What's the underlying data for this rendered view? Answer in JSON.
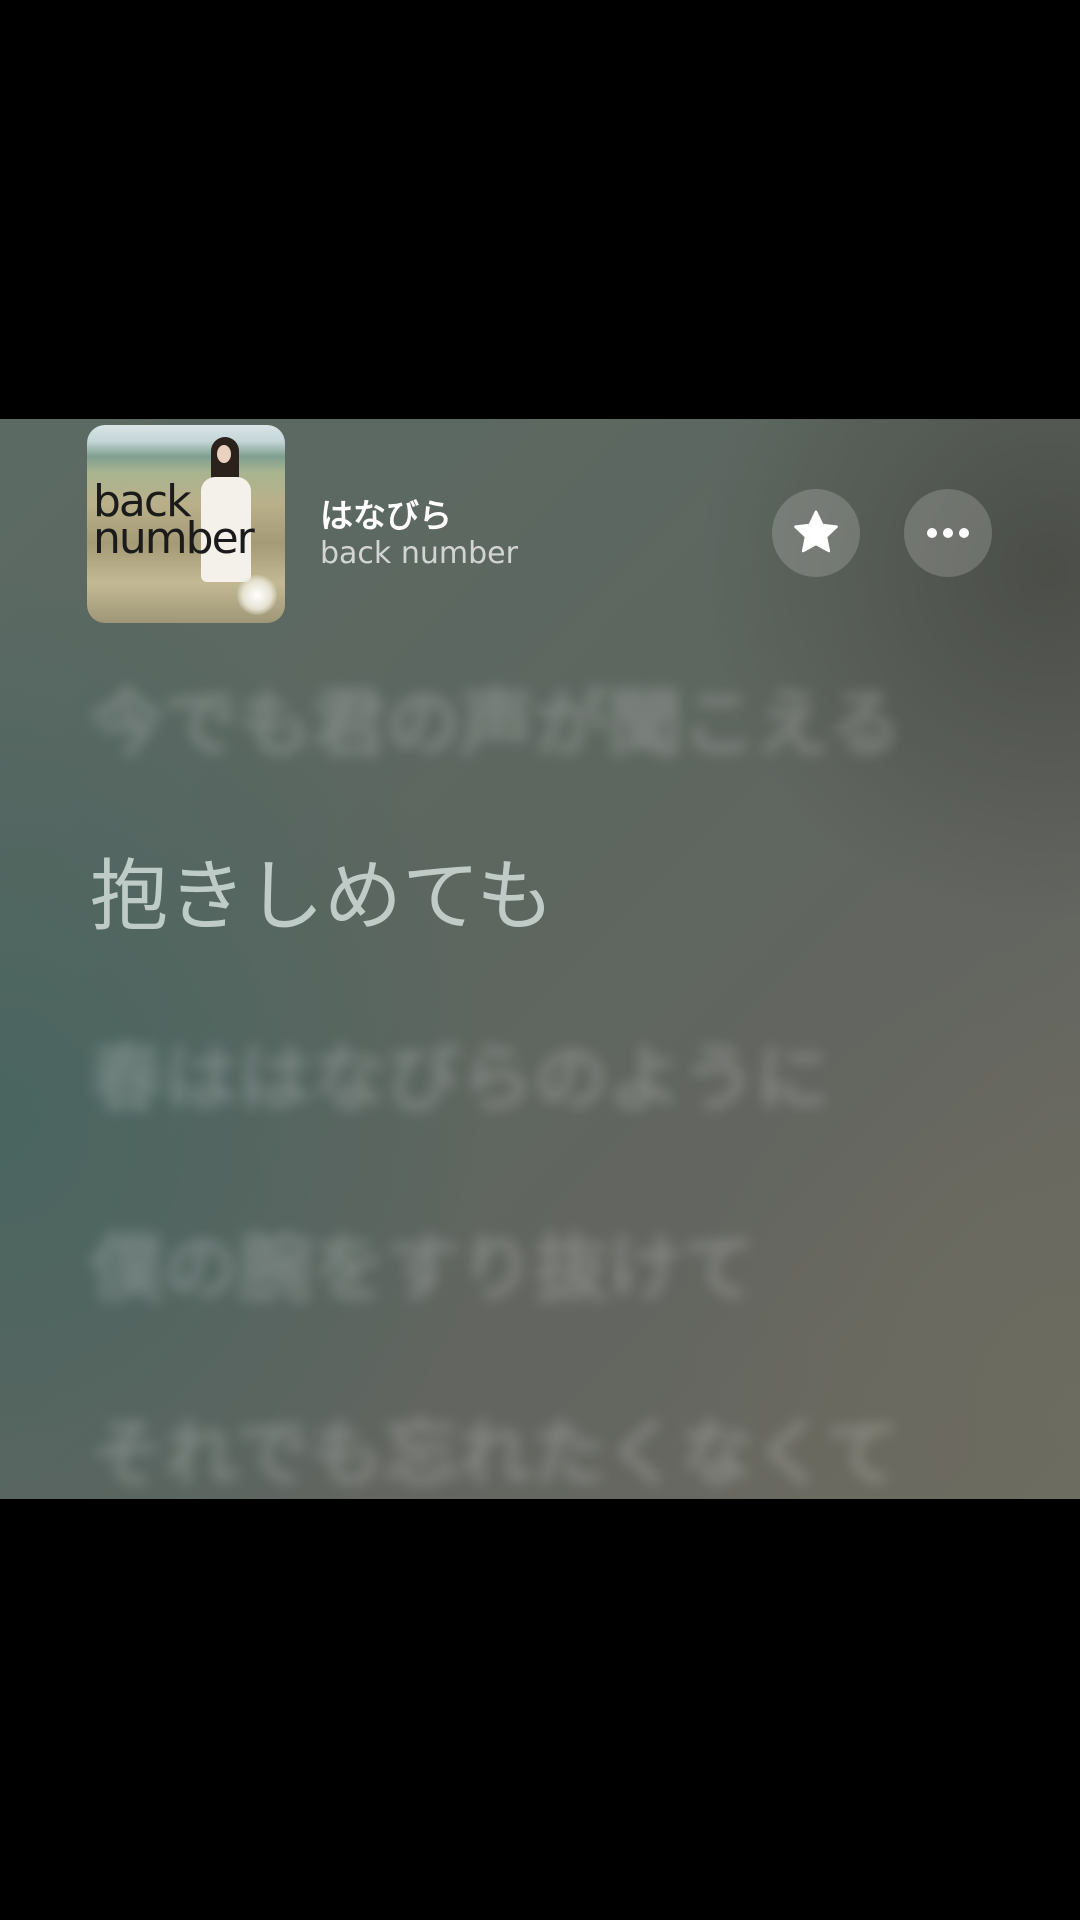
{
  "track": {
    "title": "はなびら",
    "artist": "back number"
  },
  "album_art": {
    "text_line1": "back",
    "text_line2": "number"
  },
  "buttons": {
    "favorite_icon": "star-icon",
    "more_icon": "ellipsis-icon"
  },
  "lyrics": {
    "previous": "今でも君の声が聞こえる",
    "current": "抱きしめても",
    "next1": "春ははなびらのように",
    "next2": "僕の腕をすり抜けて",
    "next3": "それでも忘れたくなくて"
  },
  "colors": {
    "background": "#5e6660",
    "current_lyric": "#dce8e4"
  }
}
